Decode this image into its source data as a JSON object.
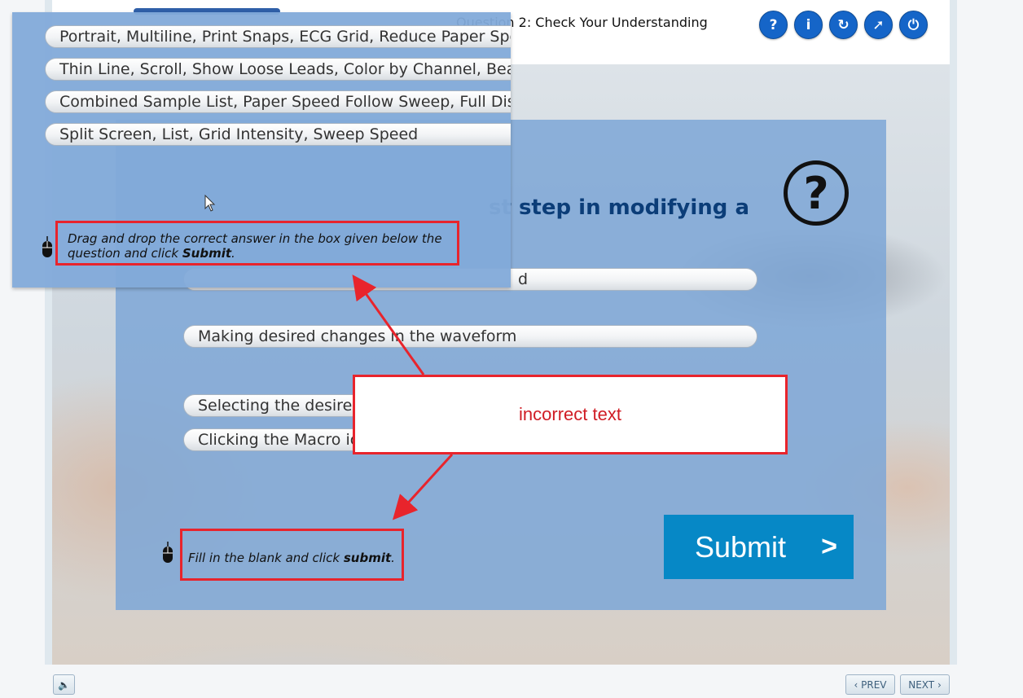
{
  "header": {
    "title": "Question 2: Check Your Understanding",
    "icons": [
      {
        "name": "help-icon",
        "glyph": "?"
      },
      {
        "name": "info-icon",
        "glyph": "i"
      },
      {
        "name": "restart-icon",
        "glyph": "↻"
      },
      {
        "name": "compass-icon",
        "glyph": "➚"
      },
      {
        "name": "power-icon",
        "glyph": "⏻"
      }
    ]
  },
  "question": {
    "visible_text": "st step in modifying a"
  },
  "options": [
    "d",
    "Making desired changes in the waveform",
    "Selecting the desired",
    "Clicking the Macro ic"
  ],
  "submit": {
    "label": "Submit",
    "chevron": ">"
  },
  "instruction": {
    "prefix": "Fill in the blank and click ",
    "bold": "submit",
    "suffix": "."
  },
  "popup": {
    "options": [
      "Portrait, Multiline, Print Snaps, ECG Grid, Reduce Paper Spee",
      "Thin Line, Scroll, Show Loose Leads, Color by Channel, Beat",
      "Combined Sample List, Paper Speed Follow Sweep, Full Dis",
      "Split Screen, List, Grid Intensity, Sweep Speed"
    ],
    "instruction": {
      "prefix": "Drag and drop the correct answer in the box given below the question and click ",
      "bold": "Submit",
      "suffix": "."
    }
  },
  "annotation": {
    "callout_text": "incorrect text"
  },
  "footer": {
    "prev_label": "PREV",
    "next_label": "NEXT",
    "audio_icon": "speaker-icon"
  },
  "colors": {
    "accent_blue": "#1565c8",
    "submit_blue": "#0688c6",
    "panel_blue": "#7ea6d6",
    "question_text": "#0b3d78",
    "annotation_red": "#e8242c"
  }
}
